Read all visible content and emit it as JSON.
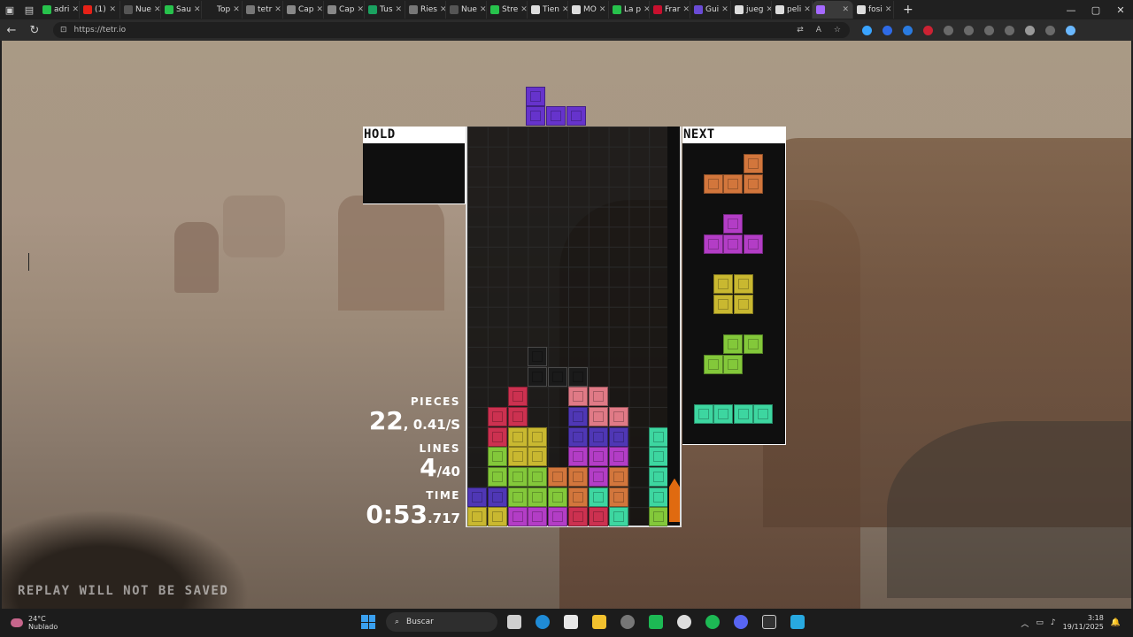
{
  "browser": {
    "tabs": [
      {
        "label": "adri",
        "color": "#27c24c"
      },
      {
        "label": "(1) ",
        "color": "#e62117"
      },
      {
        "label": "Nue",
        "color": "#555555"
      },
      {
        "label": "Sau",
        "color": "#27c24c"
      },
      {
        "label": "Top",
        "color": "#202020"
      },
      {
        "label": "tetr",
        "color": "#777777"
      },
      {
        "label": "Cap",
        "color": "#888888"
      },
      {
        "label": "Cap",
        "color": "#888888"
      },
      {
        "label": "Tus",
        "color": "#1aa260"
      },
      {
        "label": "Ries",
        "color": "#777777"
      },
      {
        "label": "Nue",
        "color": "#555555"
      },
      {
        "label": "Stre",
        "color": "#27c24c"
      },
      {
        "label": "Tien",
        "color": "#dddddd"
      },
      {
        "label": "MO",
        "color": "#dddddd"
      },
      {
        "label": "La p",
        "color": "#27c24c"
      },
      {
        "label": "Frar",
        "color": "#c8102e"
      },
      {
        "label": "Gui",
        "color": "#6a4bd6"
      },
      {
        "label": "jueg",
        "color": "#dddddd"
      },
      {
        "label": "peli",
        "color": "#dddddd"
      },
      {
        "label": "",
        "color": "#a569ff",
        "active": true
      },
      {
        "label": "fosi",
        "color": "#dddddd"
      }
    ],
    "new_tab": "+",
    "url": "https://tetr.io"
  },
  "game": {
    "hold_label": "HOLD",
    "next_label": "NEXT",
    "pieces_label": "PIECES",
    "pieces_value": "22",
    "pps_value": ", 0.41/S",
    "lines_label": "LINES",
    "lines_value": "4",
    "lines_goal": "/40",
    "time_label": "TIME",
    "time_value": "0:53",
    "time_ms": ".717",
    "replay_notice": "REPLAY WILL NOT BE SAVED",
    "garbage_level": 0.11,
    "colors": {
      "T": "#b33dc6",
      "Tactive": "#6633cc",
      "O": "#c9b830",
      "S": "#83c83a",
      "Z": "#cc3150",
      "L": "#d2763c",
      "J": "#4f37b5",
      "I": "#3dd6a0",
      "ghost": "#1a1a1a",
      "zhl": "#e07a86"
    },
    "falling_piece": {
      "type": "J",
      "cells": [
        [
          0,
          -2
        ],
        [
          0,
          -1
        ],
        [
          1,
          -1
        ],
        [
          2,
          -1
        ]
      ]
    },
    "ghost_cells": [
      [
        3,
        11
      ],
      [
        3,
        12
      ],
      [
        4,
        12
      ],
      [
        5,
        12
      ]
    ],
    "board_cells": [
      {
        "c": 2,
        "r": 13,
        "t": "Z"
      },
      {
        "c": 5,
        "r": 13,
        "t": "zhl"
      },
      {
        "c": 6,
        "r": 13,
        "t": "zhl"
      },
      {
        "c": 1,
        "r": 14,
        "t": "Z"
      },
      {
        "c": 2,
        "r": 14,
        "t": "Z"
      },
      {
        "c": 5,
        "r": 14,
        "t": "J"
      },
      {
        "c": 6,
        "r": 14,
        "t": "zhl"
      },
      {
        "c": 7,
        "r": 14,
        "t": "zhl"
      },
      {
        "c": 1,
        "r": 15,
        "t": "Z"
      },
      {
        "c": 2,
        "r": 15,
        "t": "O"
      },
      {
        "c": 3,
        "r": 15,
        "t": "O"
      },
      {
        "c": 5,
        "r": 15,
        "t": "J"
      },
      {
        "c": 6,
        "r": 15,
        "t": "J"
      },
      {
        "c": 7,
        "r": 15,
        "t": "J"
      },
      {
        "c": 9,
        "r": 15,
        "t": "I"
      },
      {
        "c": 1,
        "r": 16,
        "t": "S"
      },
      {
        "c": 2,
        "r": 16,
        "t": "O"
      },
      {
        "c": 3,
        "r": 16,
        "t": "O"
      },
      {
        "c": 5,
        "r": 16,
        "t": "T"
      },
      {
        "c": 6,
        "r": 16,
        "t": "T"
      },
      {
        "c": 7,
        "r": 16,
        "t": "T"
      },
      {
        "c": 9,
        "r": 16,
        "t": "I"
      },
      {
        "c": 1,
        "r": 17,
        "t": "S"
      },
      {
        "c": 2,
        "r": 17,
        "t": "S"
      },
      {
        "c": 3,
        "r": 17,
        "t": "S"
      },
      {
        "c": 4,
        "r": 17,
        "t": "L"
      },
      {
        "c": 5,
        "r": 17,
        "t": "L"
      },
      {
        "c": 6,
        "r": 17,
        "t": "T"
      },
      {
        "c": 7,
        "r": 17,
        "t": "L"
      },
      {
        "c": 9,
        "r": 17,
        "t": "I"
      },
      {
        "c": 0,
        "r": 18,
        "t": "J"
      },
      {
        "c": 1,
        "r": 18,
        "t": "J"
      },
      {
        "c": 2,
        "r": 18,
        "t": "S"
      },
      {
        "c": 3,
        "r": 18,
        "t": "S"
      },
      {
        "c": 4,
        "r": 18,
        "t": "S"
      },
      {
        "c": 5,
        "r": 18,
        "t": "L"
      },
      {
        "c": 6,
        "r": 18,
        "t": "I"
      },
      {
        "c": 7,
        "r": 18,
        "t": "L"
      },
      {
        "c": 9,
        "r": 18,
        "t": "I"
      },
      {
        "c": 0,
        "r": 19,
        "t": "O"
      },
      {
        "c": 1,
        "r": 19,
        "t": "O"
      },
      {
        "c": 2,
        "r": 19,
        "t": "T"
      },
      {
        "c": 3,
        "r": 19,
        "t": "T"
      },
      {
        "c": 4,
        "r": 19,
        "t": "T"
      },
      {
        "c": 5,
        "r": 19,
        "t": "Z"
      },
      {
        "c": 6,
        "r": 19,
        "t": "Z"
      },
      {
        "c": 7,
        "r": 19,
        "t": "I"
      },
      {
        "c": 9,
        "r": 19,
        "t": "S"
      }
    ],
    "next_queue": [
      {
        "type": "L",
        "cells": [
          [
            2,
            0
          ],
          [
            0,
            1
          ],
          [
            1,
            1
          ],
          [
            2,
            1
          ]
        ]
      },
      {
        "type": "T",
        "cells": [
          [
            1,
            0
          ],
          [
            0,
            1
          ],
          [
            1,
            1
          ],
          [
            2,
            1
          ]
        ]
      },
      {
        "type": "O",
        "cells": [
          [
            0,
            0
          ],
          [
            1,
            0
          ],
          [
            0,
            1
          ],
          [
            1,
            1
          ]
        ]
      },
      {
        "type": "S",
        "cells": [
          [
            1,
            0
          ],
          [
            2,
            0
          ],
          [
            0,
            1
          ],
          [
            1,
            1
          ]
        ]
      },
      {
        "type": "I",
        "cells": [
          [
            0,
            0
          ],
          [
            1,
            0
          ],
          [
            2,
            0
          ],
          [
            3,
            0
          ]
        ]
      }
    ]
  },
  "taskbar": {
    "temperature": "24°C",
    "weather": "Nublado",
    "search_placeholder": "Buscar",
    "time": "3:18",
    "date": "19/11/2025"
  }
}
